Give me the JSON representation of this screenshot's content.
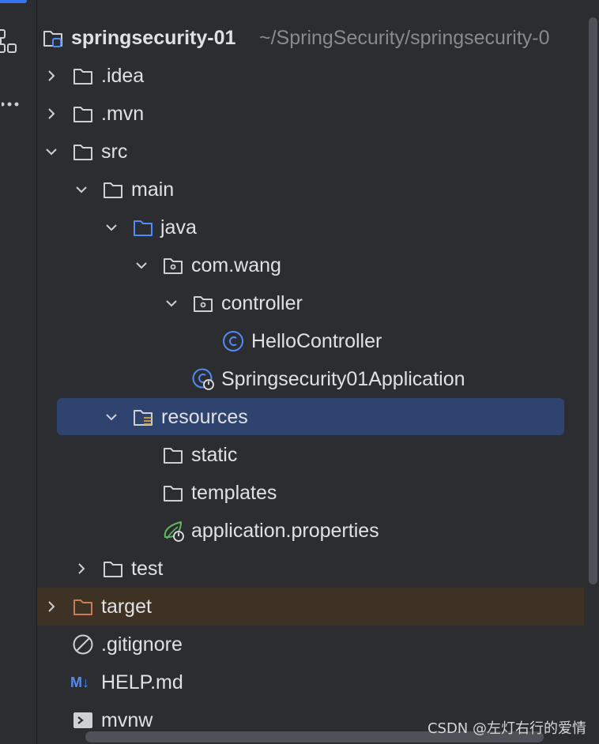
{
  "project": {
    "name": "springsecurity-01",
    "path": "~/SpringSecurity/springsecurity-0"
  },
  "tree": {
    "idea": ".idea",
    "mvn": ".mvn",
    "src": "src",
    "main": "main",
    "java": "java",
    "pkg": "com.wang",
    "controller": "controller",
    "hello_controller": "HelloController",
    "application_class": "Springsecurity01Application",
    "resources": "resources",
    "static": "static",
    "templates": "templates",
    "properties": "application.properties",
    "test": "test",
    "target": "target",
    "gitignore": ".gitignore",
    "help_md": "HELP.md",
    "mvnw": "mvnw",
    "md_badge": "M↓"
  },
  "icons": {
    "folder": "folder-icon",
    "source_folder": "source-folder-icon",
    "package": "package-icon",
    "class": "class-icon",
    "spring_app": "spring-boot-app-icon",
    "resources_folder": "resources-folder-icon",
    "spring_config": "spring-properties-icon",
    "ignore": "ignore-file-icon",
    "markdown": "markdown-icon",
    "shell": "shell-script-icon"
  },
  "colors": {
    "background": "#2b2d30",
    "selection": "#2e436e",
    "excluded": "#3d3223",
    "text": "#dfe1e5",
    "muted": "#868a91",
    "accent": "#3574f0",
    "class_blue": "#548af7",
    "excluded_orange": "#c77d55",
    "spring_green": "#5fb85f"
  },
  "watermark": "CSDN @左灯右行的爱情"
}
